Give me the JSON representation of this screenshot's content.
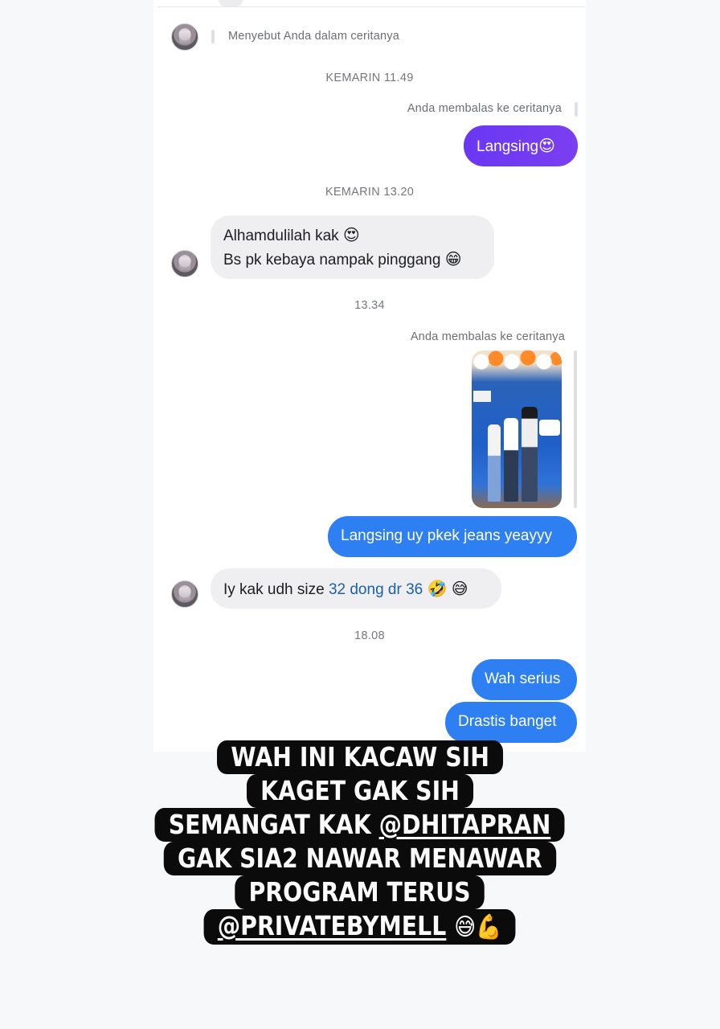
{
  "mention": {
    "text": "Menyebut Anda dalam ceritanya"
  },
  "stamps": [
    "KEMARIN 11.49",
    "KEMARIN 13.20",
    "13.34",
    "18.08"
  ],
  "reply_labels": [
    "Anda membalas ke ceritanya",
    "Anda membalas ke ceritanya"
  ],
  "messages": {
    "m1": "Langsing",
    "m2a": "Alhamdulilah kak",
    "m2b": "Bs pk kebaya nampak pinggang",
    "m3": "Langsing uy pkek jeans yeayyy",
    "m4_prefix": "Iy kak udh size ",
    "m4_link": "32 dong dr 36",
    "m5": "Wah serius",
    "m6": "Drastis banget"
  },
  "emoji": {
    "heart_eyes": "😍",
    "grin": "😁",
    "rofl": "🤣",
    "sweat_smile": "😅",
    "muscle": "💪"
  },
  "story_thumbnail": {
    "icon": "story-photo-thumbnail"
  },
  "caption": {
    "line1": "WAH INI KACAW SIH",
    "line2": "KAGET GAK SIH",
    "line3_prefix": "SEMANGAT KAK ",
    "line3_mention": "@DHITAPRAN",
    "line4": "GAK SIA2 NAWAR MENAWAR",
    "line5": "PROGRAM TERUS",
    "line6_mention": "@PRIVATEBYMELL"
  },
  "colors": {
    "purple_bubble": "#6a37f2",
    "blue_bubble": "#2d7ff2",
    "grey_bubble": "#efeff1",
    "caption_bg": "#0b0b0c"
  }
}
